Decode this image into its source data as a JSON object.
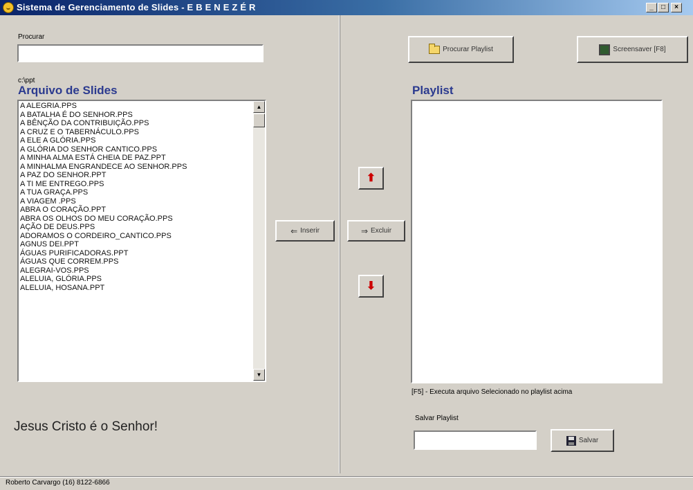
{
  "window": {
    "title": "Sistema de Gerenciamento de Slides - E B E N E Z É R",
    "min_label": "_",
    "max_label": "□",
    "close_label": "×"
  },
  "left": {
    "search_label": "Procurar",
    "search_value": "",
    "path": "c:\\ppt",
    "files_heading": "Arquivo de Slides",
    "files": [
      "A ALEGRIA.PPS",
      "A BATALHA É DO SENHOR.PPS",
      "A BÊNÇÃO DA CONTRIBUIÇÃO.PPS",
      "A CRUZ E O TABERNÁCULO.PPS",
      "A ELE A GLÓRIA.PPS",
      "A GLÓRIA DO SENHOR CANTICO.PPS",
      "A MINHA ALMA ESTÁ CHEIA DE PAZ.PPT",
      "A MINHALMA ENGRANDECE AO SENHOR.PPS",
      "A PAZ DO SENHOR.PPT",
      "A TI ME ENTREGO.PPS",
      "A TUA GRAÇA.PPS",
      "A VIAGEM .PPS",
      "ABRA O CORAÇÃO.PPT",
      "ABRA OS OLHOS DO MEU CORAÇÃO.PPS",
      "AÇÃO DE DEUS.PPS",
      "ADORAMOS O CORDEIRO_CANTICO.PPS",
      "AGNUS DEI.PPT",
      "ÁGUAS PURIFICADORAS.PPT",
      "ÁGUAS QUE CORREM.PPS",
      "ALEGRAI-VOS.PPS",
      "ALELUIA, GLÓRIA.PPS",
      "ALELUIA, HOSANA.PPT"
    ],
    "slogan": "Jesus Cristo é o Senhor!"
  },
  "middle": {
    "insert_label": "Inserir",
    "delete_label": "Excluir",
    "up_icon": "red-up-arrow-icon",
    "down_icon": "red-down-arrow-icon"
  },
  "right": {
    "search_playlist_label": "Procurar Playlist",
    "screensaver_label": "Screensaver [F8]",
    "playlist_heading": "Playlist",
    "playlist_items": [],
    "hint": "[F5] - Executa arquivo Selecionado no playlist acima",
    "save_label": "Salvar Playlist",
    "save_value": "",
    "save_button": "Salvar"
  },
  "status": {
    "text": "Roberto Carvargo (16) 8122-6866"
  },
  "colors": {
    "accent_heading": "#2b3a8f",
    "arrow": "#c00000"
  }
}
